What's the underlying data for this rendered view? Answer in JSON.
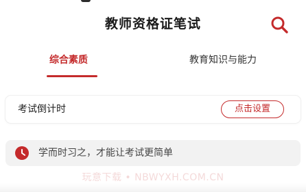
{
  "header": {
    "title": "教师资格证笔试",
    "search_icon": "search-icon"
  },
  "tabs": [
    {
      "label": "综合素质",
      "active": true
    },
    {
      "label": "教育知识与能力",
      "active": false
    }
  ],
  "countdown": {
    "label": "考试倒计时",
    "button_label": "点击设置"
  },
  "quote": {
    "icon": "clock-icon",
    "text": "学而时习之，才能让考试更简单"
  },
  "watermark": {
    "text": "玩意下载 • NBWYXH.COM.CN"
  },
  "colors": {
    "accent": "#c42a2b",
    "text": "#222222",
    "muted_bg": "#f2f2f2"
  }
}
